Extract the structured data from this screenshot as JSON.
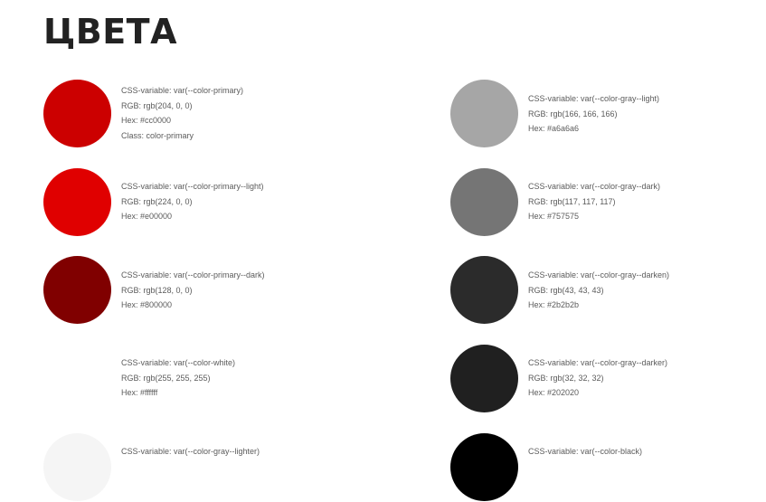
{
  "page_title": "ЦВЕТА",
  "swatches": [
    {
      "color": "#cc0000",
      "css_variable": "CSS-variable: var(--color-primary)",
      "rgb": "RGB: rgb(204, 0, 0)",
      "hex": "Hex: #cc0000",
      "class": "Class: color-primary"
    },
    {
      "color": "#e00000",
      "css_variable": "CSS-variable: var(--color-primary--light)",
      "rgb": "RGB: rgb(224, 0, 0)",
      "hex": "Hex: #e00000"
    },
    {
      "color": "#800000",
      "css_variable": "CSS-variable: var(--color-primary--dark)",
      "rgb": "RGB: rgb(128, 0, 0)",
      "hex": "Hex: #800000"
    },
    {
      "color": "#ffffff",
      "css_variable": "CSS-variable: var(--color-white)",
      "rgb": "RGB: rgb(255, 255, 255)",
      "hex": "Hex: #ffffff"
    },
    {
      "color": "#f5f5f5",
      "css_variable": "CSS-variable: var(--color-gray--lighter)"
    },
    {
      "color": "#a6a6a6",
      "css_variable": "CSS-variable: var(--color-gray--light)",
      "rgb": "RGB: rgb(166, 166, 166)",
      "hex": "Hex: #a6a6a6"
    },
    {
      "color": "#757575",
      "css_variable": "CSS-variable: var(--color-gray--dark)",
      "rgb": "RGB: rgb(117, 117, 117)",
      "hex": "Hex: #757575"
    },
    {
      "color": "#2b2b2b",
      "css_variable": "CSS-variable: var(--color-gray--darken)",
      "rgb": "RGB: rgb(43, 43, 43)",
      "hex": "Hex: #2b2b2b"
    },
    {
      "color": "#202020",
      "css_variable": "CSS-variable: var(--color-gray--darker)",
      "rgb": "RGB: rgb(32, 32, 32)",
      "hex": "Hex: #202020"
    },
    {
      "color": "#000000",
      "css_variable": "CSS-variable: var(--color-black)"
    }
  ]
}
